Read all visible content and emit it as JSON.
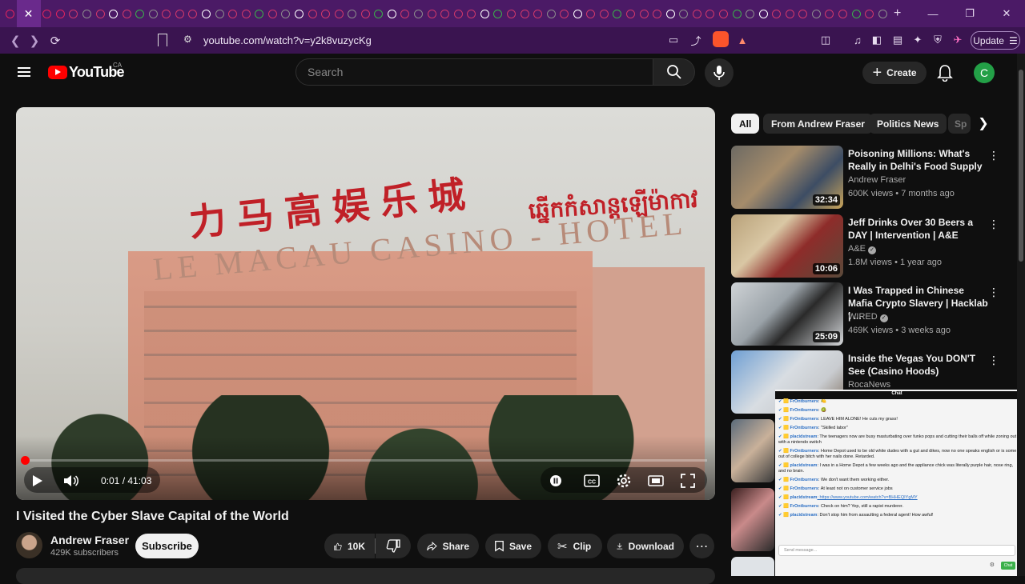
{
  "browser": {
    "url": "youtube.com/watch?v=y2k8vuzycKg",
    "update_label": "Update",
    "tab_count": 66
  },
  "header": {
    "logo_text": "YouTube",
    "country": "CA",
    "search_placeholder": "Search",
    "create_label": "Create",
    "avatar_letter": "C"
  },
  "player": {
    "time": "0:01 / 41:03",
    "progress": 0.0004,
    "sign_cn": "力马高娱乐城",
    "sign_kh": "ឆ្នើកកំសាន្តឡើម៉ាកាវ",
    "sign_hotel": "LE MACAU CASINO - HOTEL"
  },
  "video": {
    "title": "I Visited the Cyber Slave Capital of the World",
    "channel": "Andrew Fraser",
    "subscribers": "429K subscribers",
    "subscribe_label": "Subscribe",
    "likes": "10K",
    "share_label": "Share",
    "save_label": "Save",
    "clip_label": "Clip",
    "download_label": "Download"
  },
  "chips": [
    "All",
    "From Andrew Fraser",
    "Politics News",
    "Sp"
  ],
  "recommendations": [
    {
      "title": "Poisoning Millions: What's Really in Delhi's Food Supply",
      "channel": "Andrew Fraser",
      "meta": "600K views • 7 months ago",
      "duration": "32:34",
      "verified": false
    },
    {
      "title": "Jeff Drinks Over 30 Beers a DAY | Intervention | A&E",
      "channel": "A&E",
      "meta": "1.8M views • 1 year ago",
      "duration": "10:06",
      "verified": true
    },
    {
      "title": "I Was Trapped in Chinese Mafia Crypto Slavery | Hacklab | ...",
      "channel": "WIRED",
      "meta": "469K views • 3 weeks ago",
      "duration": "25:09",
      "verified": true
    },
    {
      "title": "Inside the Vegas You DON'T See (Casino Hoods)",
      "channel": "RocaNews",
      "meta": "",
      "duration": "",
      "verified": false
    }
  ],
  "chat": {
    "header": "Chat",
    "input_placeholder": "Send message...",
    "send_label": "Chat",
    "messages": [
      {
        "user": "FrOntburners",
        "text": ": 🍋"
      },
      {
        "user": "FrOntburners",
        "text": ": 🥝"
      },
      {
        "user": "FrOntburners",
        "text": ": LEAVE HIM ALONE! He cuts my grass!"
      },
      {
        "user": "FrOntburners",
        "text": ": \"Skilled labor\""
      },
      {
        "user": "placidstream",
        "text": ": The teenagers now are busy masturbating over funko pops and cutting their balls off while zoning out with a nintendo switch"
      },
      {
        "user": "FrOntburners",
        "text": ": Home Depot used to be old white dudes with a gut and dikes, now no one speaks english or is some out of college bitch with her nails done. Retarded."
      },
      {
        "user": "placidstream",
        "text": ": I was in a Home Depot a few weeks ago and the appliance chick was literally purple hair, nose ring, and no brain."
      },
      {
        "user": "FrOntburners",
        "text": ": We don't want them working either."
      },
      {
        "user": "FrOntburners",
        "text": ": At least not on customer service jobs"
      },
      {
        "user": "placidstream",
        "text": ": https://www.youtube.com/watch?v=BHHEQIYgMY"
      },
      {
        "user": "FrOntburners",
        "text": ": Check on him? Yep, still a rapist murderer."
      },
      {
        "user": "placidstream",
        "text": ": Don't stop him from assaulting a federal agent! How awful!"
      }
    ]
  }
}
